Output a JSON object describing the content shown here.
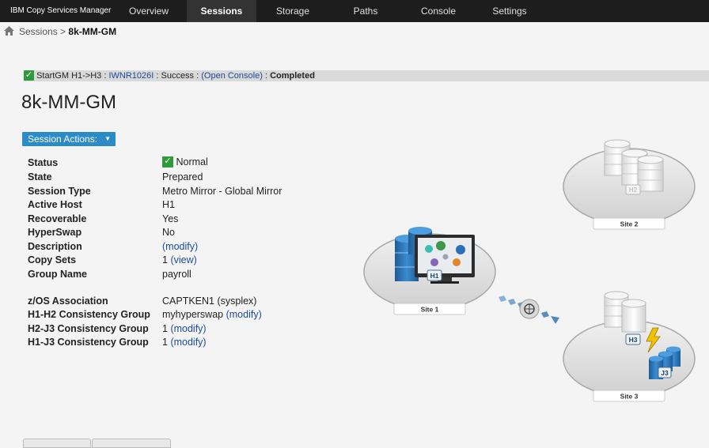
{
  "app": {
    "title": "IBM Copy Services Manager"
  },
  "nav": {
    "tabs": [
      "Overview",
      "Sessions",
      "Storage",
      "Paths",
      "Console",
      "Settings"
    ],
    "active": "Sessions"
  },
  "breadcrumb": {
    "parent": "Sessions",
    "separator": ">",
    "current": "8k-MM-GM"
  },
  "status": {
    "command": "StartGM H1->H3 :",
    "message_id": "IWNR1026I",
    "result": ": Success :",
    "console_link": "(Open Console)",
    "tail": ":",
    "state": "Completed"
  },
  "session": {
    "title": "8k-MM-GM",
    "actions_label": "Session Actions:",
    "properties": [
      {
        "label": "Status",
        "value": "Normal"
      },
      {
        "label": "State",
        "value": "Prepared"
      },
      {
        "label": "Session Type",
        "value": "Metro Mirror - Global Mirror"
      },
      {
        "label": "Active Host",
        "value": "H1"
      },
      {
        "label": "Recoverable",
        "value": "Yes"
      },
      {
        "label": "HyperSwap",
        "value": "No"
      },
      {
        "label": "Description",
        "value": "",
        "link": "(modify)"
      },
      {
        "label": "Copy Sets",
        "value": "1",
        "link": "(view)"
      },
      {
        "label": "Group Name",
        "value": "payroll"
      },
      {
        "label": "z/OS Association",
        "value": "CAPTKEN1 (sysplex)"
      },
      {
        "label": "H1-H2 Consistency Group",
        "value": "myhyperswap",
        "link": "(modify)"
      },
      {
        "label": "H2-J3 Consistency Group",
        "value": "1",
        "link": "(modify)"
      },
      {
        "label": "H1-J3 Consistency Group",
        "value": "1",
        "link": "(modify)"
      }
    ]
  },
  "diagram": {
    "sites": [
      {
        "name": "Site 1",
        "volume": "H1"
      },
      {
        "name": "Site 2",
        "volume": "H2"
      },
      {
        "name": "Site 3",
        "volume": "H3",
        "journal": "J3"
      }
    ]
  },
  "colors": {
    "accent": "#2b8bc6",
    "link": "#1a4b9b",
    "success": "#2e9a3c",
    "topbar": "#1d1d1d"
  }
}
